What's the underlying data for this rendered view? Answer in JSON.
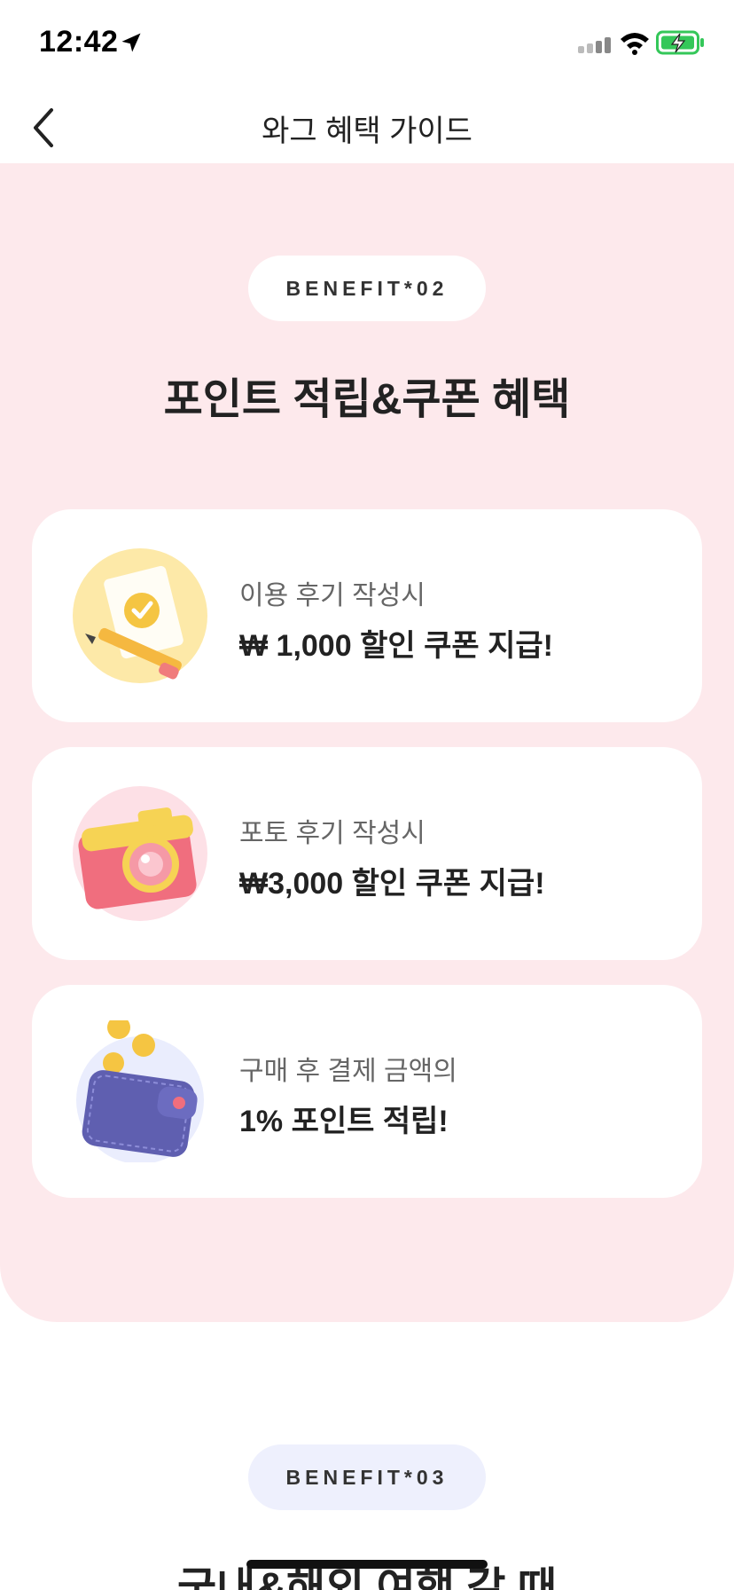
{
  "status_bar": {
    "time": "12:42"
  },
  "nav": {
    "title": "와그 혜택 가이드"
  },
  "benefit2": {
    "badge": "BENEFIT*02",
    "title": "포인트 적립&쿠폰 혜택",
    "cards": [
      {
        "sub": "이용 후기 작성시",
        "main": "₩ 1,000 할인 쿠폰 지급!",
        "icon": "review-pencil-icon"
      },
      {
        "sub": "포토 후기 작성시",
        "main": "₩3,000 할인 쿠폰 지급!",
        "icon": "camera-icon"
      },
      {
        "sub": "구매 후 결제 금액의",
        "main": "1% 포인트 적립!",
        "icon": "wallet-coins-icon"
      }
    ]
  },
  "benefit3": {
    "badge": "BENEFIT*03",
    "title": "국내&해외 여행 갈 때"
  },
  "colors": {
    "pink_bg": "#fde9ec",
    "lavender_badge": "#eef0fd",
    "battery_green": "#34c759"
  }
}
